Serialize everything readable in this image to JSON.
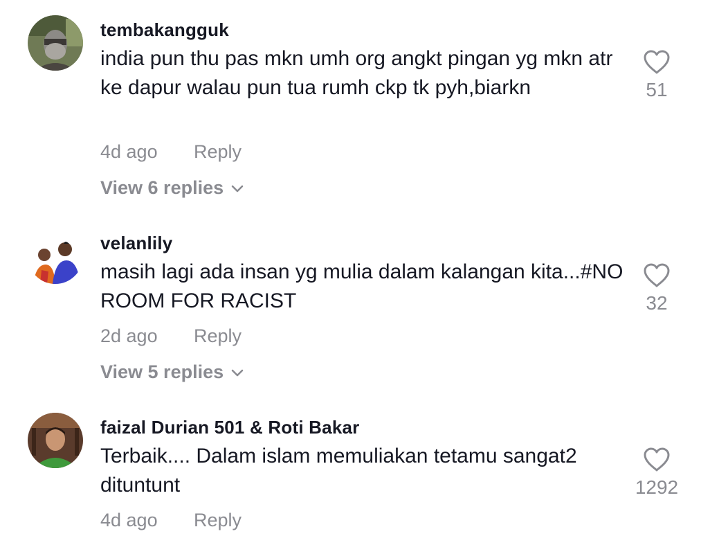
{
  "comments": [
    {
      "username": "tembakangguk",
      "text": "india pun thu pas mkn umh org angkt pingan yg mkn atr ke dapur walau pun tua rumh ckp tk pyh,biarkn",
      "time": "4d ago",
      "reply_label": "Reply",
      "view_replies": "View 6 replies",
      "likes": "51"
    },
    {
      "username": "velanlily",
      "text": "masih lagi ada insan yg mulia dalam kalangan kita...#NO ROOM FOR RACIST",
      "time": "2d ago",
      "reply_label": "Reply",
      "view_replies": "View 5 replies",
      "likes": "32"
    },
    {
      "username": "faizal Durian 501 & Roti Bakar",
      "text": "Terbaik.... Dalam islam memuliakan tetamu sangat2 dituntunt",
      "time": "4d ago",
      "reply_label": "Reply",
      "likes": "1292"
    }
  ],
  "icons": {
    "like": "heart-outline-icon",
    "expand": "chevron-down-icon"
  },
  "colors": {
    "text": "#161823",
    "secondary": "#8a8b91",
    "background": "#ffffff"
  }
}
